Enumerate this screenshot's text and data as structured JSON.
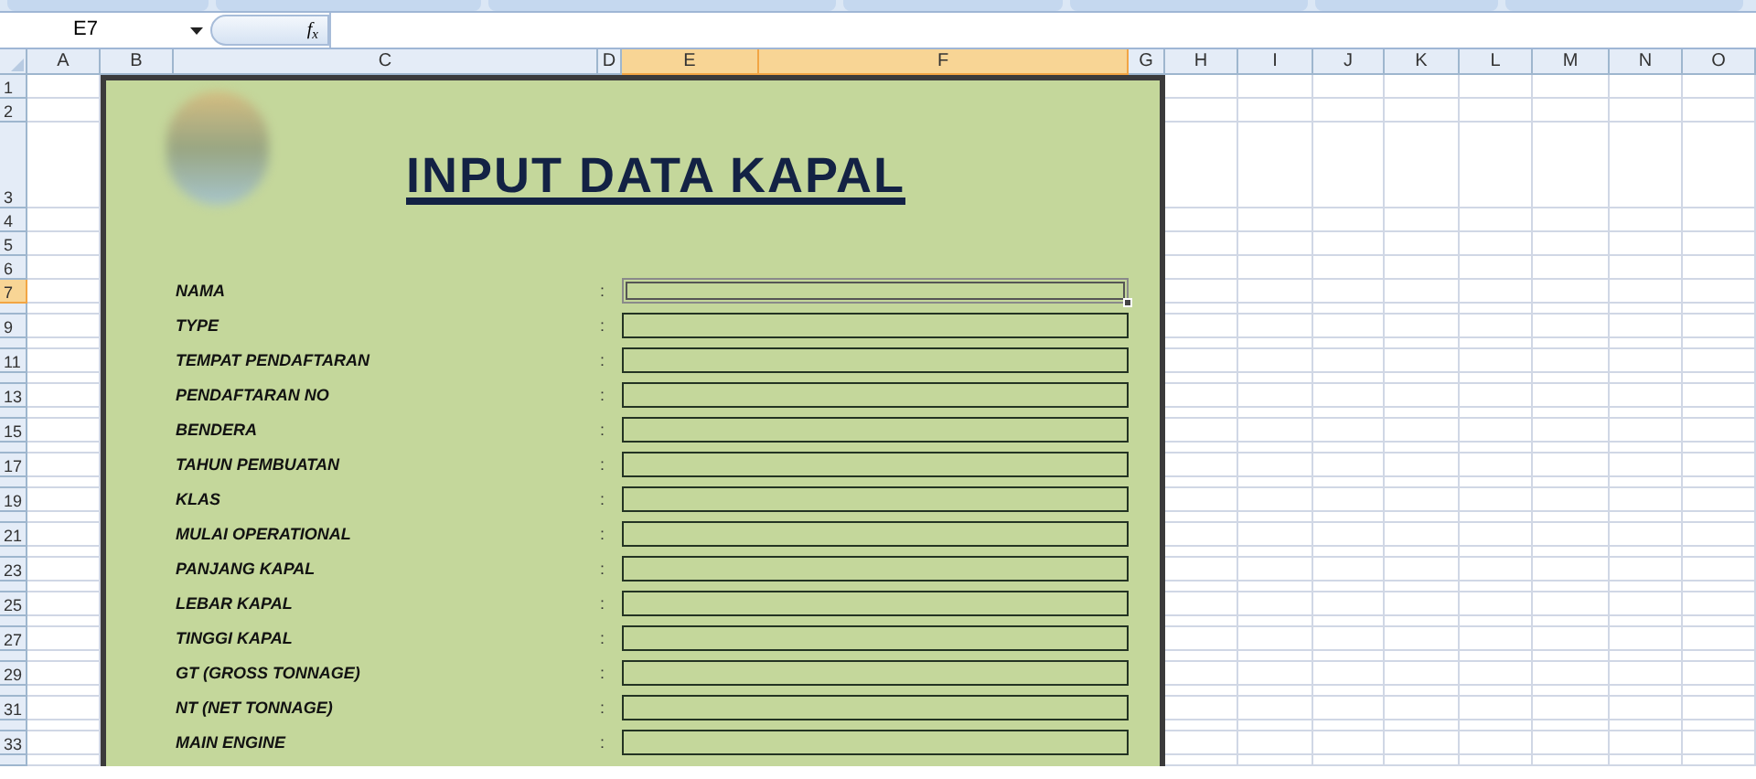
{
  "formula_bar": {
    "name_box": "E7",
    "function_label": "f$_{x}$"
  },
  "columns": [
    {
      "label": "A",
      "selected": false
    },
    {
      "label": "B",
      "selected": false
    },
    {
      "label": "C",
      "selected": false
    },
    {
      "label": "D",
      "selected": false
    },
    {
      "label": "E",
      "selected": true
    },
    {
      "label": "F",
      "selected": true
    },
    {
      "label": "G",
      "selected": false
    },
    {
      "label": "H",
      "selected": false
    },
    {
      "label": "I",
      "selected": false
    },
    {
      "label": "J",
      "selected": false
    },
    {
      "label": "K",
      "selected": false
    },
    {
      "label": "L",
      "selected": false
    },
    {
      "label": "M",
      "selected": false
    },
    {
      "label": "N",
      "selected": false
    },
    {
      "label": "O",
      "selected": false
    }
  ],
  "rows": [
    {
      "label": "1",
      "selected": false
    },
    {
      "label": "2",
      "selected": false
    },
    {
      "label": "3",
      "selected": false
    },
    {
      "label": "4",
      "selected": false
    },
    {
      "label": "5",
      "selected": false
    },
    {
      "label": "6",
      "selected": false
    },
    {
      "label": "7",
      "selected": true
    },
    {
      "selected": false
    },
    {
      "label": "9",
      "selected": false
    },
    {
      "selected": false
    },
    {
      "label": "11",
      "selected": false
    },
    {
      "selected": false
    },
    {
      "label": "13",
      "selected": false
    },
    {
      "selected": false
    },
    {
      "label": "15",
      "selected": false
    },
    {
      "selected": false
    },
    {
      "label": "17",
      "selected": false
    },
    {
      "selected": false
    },
    {
      "label": "19",
      "selected": false
    },
    {
      "selected": false
    },
    {
      "label": "21",
      "selected": false
    },
    {
      "selected": false
    },
    {
      "label": "23",
      "selected": false
    },
    {
      "selected": false
    },
    {
      "label": "25",
      "selected": false
    },
    {
      "selected": false
    },
    {
      "label": "27",
      "selected": false
    },
    {
      "selected": false
    },
    {
      "label": "29",
      "selected": false
    },
    {
      "selected": false
    },
    {
      "label": "31",
      "selected": false
    },
    {
      "selected": false
    },
    {
      "label": "33",
      "selected": false
    },
    {
      "selected": false
    }
  ],
  "form": {
    "title": "INPUT DATA KAPAL",
    "fields": [
      {
        "label": "NAMA",
        "separator": ":",
        "selected": true
      },
      {
        "label": "TYPE",
        "separator": ":",
        "selected": false
      },
      {
        "label": "TEMPAT PENDAFTARAN",
        "separator": ":",
        "selected": false
      },
      {
        "label": "PENDAFTARAN NO",
        "separator": ":",
        "selected": false
      },
      {
        "label": "BENDERA",
        "separator": ":",
        "selected": false
      },
      {
        "label": "TAHUN PEMBUATAN",
        "separator": ":",
        "selected": false
      },
      {
        "label": "KLAS",
        "separator": ":",
        "selected": false
      },
      {
        "label": "MULAI OPERATIONAL",
        "separator": ":",
        "selected": false
      },
      {
        "label": "PANJANG KAPAL",
        "separator": ":",
        "selected": false
      },
      {
        "label": "LEBAR KAPAL",
        "separator": ":",
        "selected": false
      },
      {
        "label": "TINGGI KAPAL",
        "separator": ":",
        "selected": false
      },
      {
        "label": "GT (GROSS TONNAGE)",
        "separator": ":",
        "selected": false
      },
      {
        "label": "NT (NET TONNAGE)",
        "separator": ":",
        "selected": false
      },
      {
        "label": "MAIN ENGINE",
        "separator": ":",
        "selected": false
      }
    ]
  }
}
